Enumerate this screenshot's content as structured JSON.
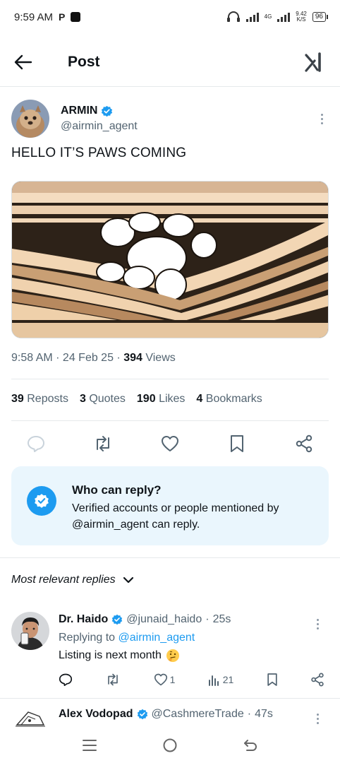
{
  "status_bar": {
    "time": "9:59 AM",
    "app_letter": "P",
    "network_type": "4G",
    "speed_value": "9.42",
    "speed_unit": "K/S",
    "battery": "96"
  },
  "header": {
    "title": "Post"
  },
  "post": {
    "author_name": "ARMIN",
    "author_handle": "@airmin_agent",
    "text": "HELLO IT’S PAWS COMING",
    "timestamp": "9:58 AM · 24 Feb 25 · ",
    "views_count": "394",
    "views_label": " Views",
    "stats": {
      "reposts_count": "39",
      "reposts_label": "Reposts",
      "quotes_count": "3",
      "quotes_label": "Quotes",
      "likes_count": "190",
      "likes_label": "Likes",
      "bookmarks_count": "4",
      "bookmarks_label": "Bookmarks"
    }
  },
  "reply_restriction": {
    "title": "Who can reply?",
    "description": "Verified accounts or people mentioned by @airmin_agent can reply."
  },
  "replies_section": {
    "sort_label": "Most relevant replies"
  },
  "replies": [
    {
      "name": "Dr. Haido",
      "handle": "@junaid_haido",
      "separator": "·",
      "time": "25s",
      "replying_prefix": "Replying to ",
      "replying_to": "@airmin_agent",
      "text": "Listing is next month",
      "likes": "1",
      "views": "21"
    },
    {
      "name": "Alex Vodopad",
      "handle": "@CashmereTrade",
      "separator": "·",
      "time": "47s"
    }
  ],
  "colors": {
    "accent": "#1d9bf0",
    "text_primary": "#0f1419",
    "text_secondary": "#536471",
    "reply_card_bg": "#eaf6fd"
  }
}
